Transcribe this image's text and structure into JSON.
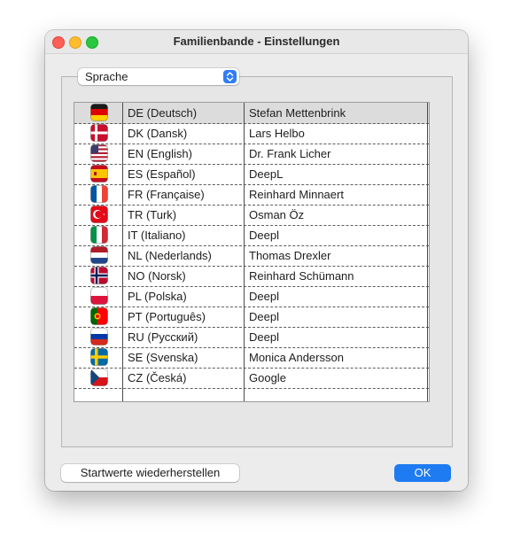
{
  "window": {
    "title": "Familienbande - Einstellungen"
  },
  "popup": {
    "selected": "Sprache"
  },
  "table": {
    "rows": [
      {
        "flag": "flag-de",
        "language": "DE (Deutsch)",
        "translator": "Stefan Mettenbrink",
        "selected": true
      },
      {
        "flag": "flag-dk",
        "language": "DK (Dansk)",
        "translator": "Lars Helbo"
      },
      {
        "flag": "flag-us",
        "language": "EN (English)",
        "translator": "Dr. Frank Licher"
      },
      {
        "flag": "flag-es",
        "language": "ES (Español)",
        "translator": "DeepL"
      },
      {
        "flag": "flag-fr",
        "language": "FR (Française)",
        "translator": "Reinhard Minnaert"
      },
      {
        "flag": "flag-tr",
        "language": "TR (Turk)",
        "translator": "Osman Öz"
      },
      {
        "flag": "flag-it",
        "language": "IT (Italiano)",
        "translator": "Deepl"
      },
      {
        "flag": "flag-nl",
        "language": "NL (Nederlands)",
        "translator": "Thomas Drexler"
      },
      {
        "flag": "flag-no",
        "language": "NO (Norsk)",
        "translator": "Reinhard Schümann"
      },
      {
        "flag": "flag-pl",
        "language": "PL (Polska)",
        "translator": "Deepl"
      },
      {
        "flag": "flag-pt",
        "language": "PT (Português)",
        "translator": "Deepl"
      },
      {
        "flag": "flag-ru",
        "language": "RU (Русский)",
        "translator": "Deepl"
      },
      {
        "flag": "flag-se",
        "language": "SE (Svenska)",
        "translator": "Monica Andersson"
      },
      {
        "flag": "flag-cz",
        "language": "CZ (Česká)",
        "translator": "Google"
      }
    ]
  },
  "buttons": {
    "reset_label": "Startwerte wiederherstellen",
    "ok_label": "OK"
  },
  "colors": {
    "accent": "#1e7bf2",
    "selected_row": "#dcdcdc"
  }
}
